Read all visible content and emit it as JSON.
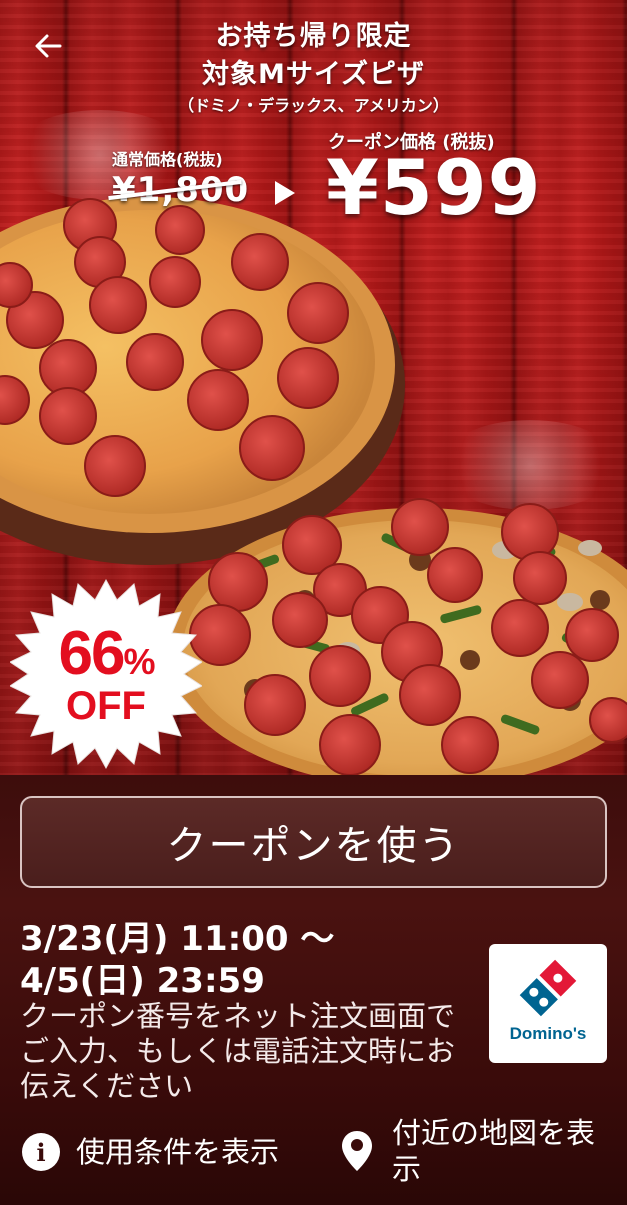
{
  "hero": {
    "back_icon": "arrow-left-icon",
    "headline_1": "お持ち帰り限定",
    "headline_2": "対象Mサイズピザ",
    "headline_3": "（ドミノ・デラックス、アメリカン）",
    "regular_label": "通常価格(税抜)",
    "regular_price": "¥1,800",
    "coupon_label": "クーポン価格 (税抜)",
    "coupon_price": "¥599",
    "badge_percent": "66",
    "badge_percent_sign": "%",
    "badge_off": "OFF",
    "badge_color": "#e30e1f"
  },
  "panel": {
    "use_coupon_label": "クーポンを使う",
    "period_line_1": "3/23(月) 11:00 〜",
    "period_line_2": "4/5(日) 23:59",
    "instructions": "クーポン番号をネット注文画面でご入力、もしくは電話注文時にお伝えください",
    "logo_text": "Domino's",
    "logo_blue": "#006491",
    "logo_red": "#e31837",
    "terms_icon": "info-icon",
    "terms_label": "使用条件を表示",
    "map_icon": "location-pin-icon",
    "map_label": "付近の地図を表示"
  }
}
